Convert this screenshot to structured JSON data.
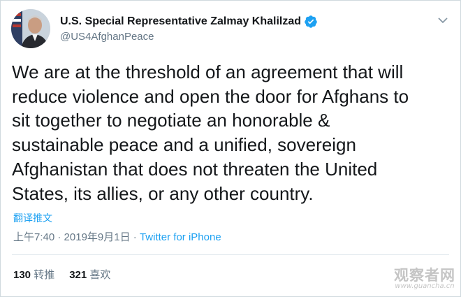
{
  "tweet": {
    "display_name": "U.S. Special Representative Zalmay Khalilzad",
    "handle": "@US4AfghanPeace",
    "verified_icon": "verified-badge-icon",
    "text": "We are at the threshold of an agreement that will\nreduce violence and open the door for Afghans to\nsit together to negotiate an honorable &\nsustainable peace and a unified, sovereign\nAfghanistan that does not threaten the United\nStates, its allies, or any other country.",
    "translate_label": "翻译推文",
    "time": "上午7:40",
    "date": "2019年9月1日",
    "separator": " · ",
    "source": "Twitter for iPhone"
  },
  "stats": {
    "retweets_count": "130",
    "retweets_label": "转推",
    "likes_count": "321",
    "likes_label": "喜欢"
  },
  "watermark": {
    "text": "观察者网",
    "url": "www.guancha.cn"
  },
  "colors": {
    "accent": "#1da1f2",
    "text": "#14171a",
    "secondary": "#657786"
  }
}
